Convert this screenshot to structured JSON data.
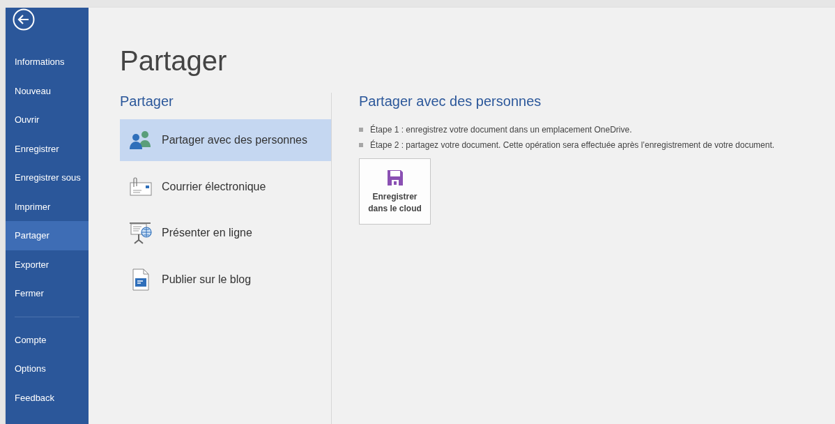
{
  "sidebar": {
    "items": [
      {
        "label": "Informations",
        "selected": false
      },
      {
        "label": "Nouveau",
        "selected": false
      },
      {
        "label": "Ouvrir",
        "selected": false
      },
      {
        "label": "Enregistrer",
        "selected": false
      },
      {
        "label": "Enregistrer sous",
        "selected": false
      },
      {
        "label": "Imprimer",
        "selected": false
      },
      {
        "label": "Partager",
        "selected": true
      },
      {
        "label": "Exporter",
        "selected": false
      },
      {
        "label": "Fermer",
        "selected": false
      }
    ],
    "footer_items": [
      {
        "label": "Compte",
        "selected": false
      },
      {
        "label": "Options",
        "selected": false
      },
      {
        "label": "Feedback",
        "selected": false
      }
    ]
  },
  "page_title": "Partager",
  "section_title": "Partager",
  "share_options": [
    {
      "kind": "people",
      "label": "Partager avec des personnes",
      "selected": true
    },
    {
      "kind": "email",
      "label": "Courrier électronique",
      "selected": false
    },
    {
      "kind": "present",
      "label": "Présenter en ligne",
      "selected": false
    },
    {
      "kind": "blog",
      "label": "Publier sur le blog",
      "selected": false
    }
  ],
  "detail": {
    "title": "Partager avec des personnes",
    "steps": [
      "Étape 1 : enregistrez votre document dans un emplacement OneDrive.",
      "Étape 2 : partagez votre document. Cette opération sera effectuée après l’enregistrement de votre document."
    ],
    "button": "Enregistrer dans le cloud"
  }
}
